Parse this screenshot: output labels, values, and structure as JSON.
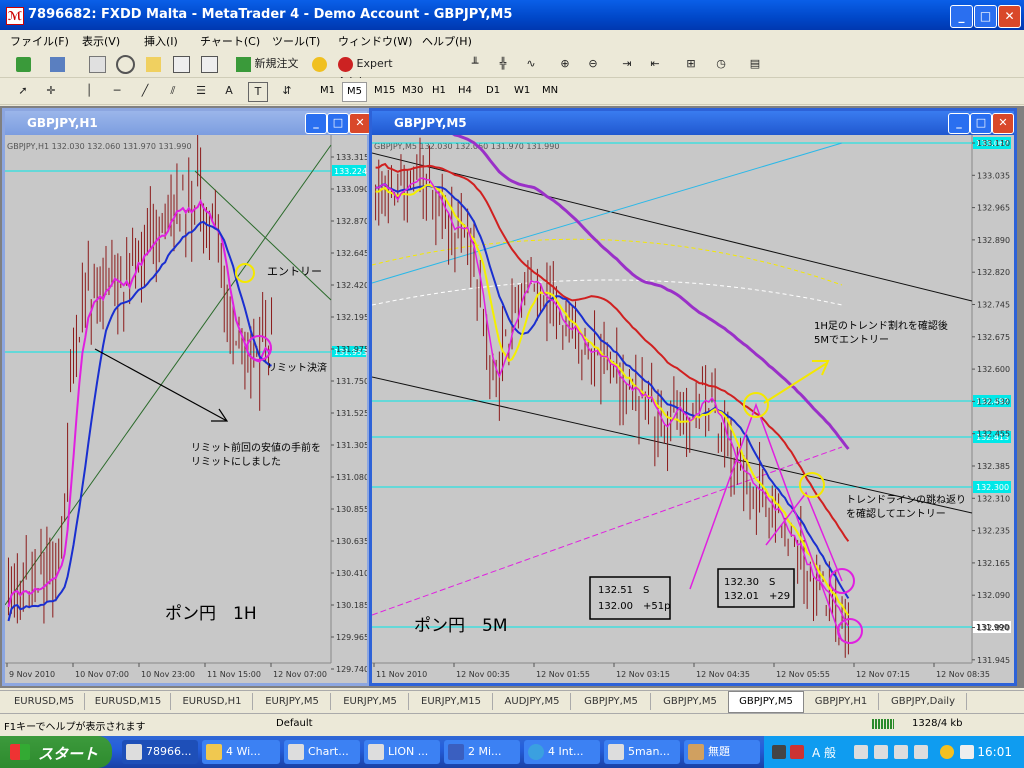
{
  "window": {
    "title": "7896682: FXDD Malta - MetaTrader 4 - Demo Account - GBPJPY,M5",
    "icon": "metatrader-icon",
    "minimize": "_",
    "maximize": "□",
    "close": "✕"
  },
  "menu": [
    "ファイル(F)",
    "表示(V)",
    "挿入(I)",
    "チャート(C)",
    "ツール(T)",
    "ウィンドウ(W)",
    "ヘルプ(H)"
  ],
  "toolbar1": {
    "new_order": "新規注文",
    "expert_advisors": "Expert Advisors"
  },
  "toolbar2": {
    "text_tool": "A",
    "label_tool": "T",
    "timeframes": [
      "M1",
      "M5",
      "M15",
      "M30",
      "H1",
      "H4",
      "D1",
      "W1",
      "MN"
    ],
    "active_timeframe": "M5"
  },
  "chart_h1": {
    "title": "GBPJPY,H1",
    "info": "GBPJPY,H1  132.030 132.060 131.970 131.990",
    "price_labels": [
      "133.315",
      "133.090",
      "132.870",
      "132.645",
      "132.420",
      "132.195",
      "131.975",
      "131.750",
      "131.525",
      "131.305",
      "131.080",
      "130.855",
      "130.635",
      "130.410",
      "130.185",
      "129.965",
      "129.740"
    ],
    "hline_top": "133.224",
    "hline_bottom": "131.953",
    "time_labels": [
      "9 Nov 2010",
      "10 Nov 07:00",
      "10 Nov 23:00",
      "11 Nov 15:00",
      "12 Nov 07:00"
    ],
    "annotations": {
      "entry": "エントリー",
      "limit_exit": "リミット決済",
      "note_line1": "リミット前回の安値の手前を",
      "note_line2": "リミットにしました",
      "big_label": "ポン円　1H"
    }
  },
  "chart_m5": {
    "title": "GBPJPY,M5",
    "info": "GBPJPY,M5  132.030 132.060 131.970 131.990",
    "price_labels": [
      "133.110",
      "133.035",
      "132.965",
      "132.890",
      "132.820",
      "132.745",
      "132.675",
      "132.600",
      "132.530",
      "132.455",
      "132.385",
      "132.310",
      "132.235",
      "132.165",
      "132.090",
      "132.020",
      "131.945"
    ],
    "hlines": [
      "133.067",
      "132.492",
      "132.413",
      "132.300",
      "131.990"
    ],
    "time_labels": [
      "11 Nov 2010",
      "12 Nov 00:35",
      "12 Nov 01:55",
      "12 Nov 03:15",
      "12 Nov 04:35",
      "12 Nov 05:55",
      "12 Nov 07:15",
      "12 Nov 08:35"
    ],
    "annotations": {
      "note1_line1": "1H足のトレンド割れを確認後",
      "note1_line2": "5Mでエントリー",
      "note2_line1": "トレンドラインの跳ね返り",
      "note2_line2": "を確認してエントリー",
      "box1_line1": "132.51　S",
      "box1_line2": "132.00　+51p",
      "box2_line1": "132.30　S",
      "box2_line2": "132.01　+29",
      "big_label": "ポン円　5M"
    }
  },
  "tabs": [
    "EURUSD,M5",
    "EURUSD,M15",
    "EURUSD,H1",
    "EURJPY,M5",
    "EURJPY,M5",
    "EURJPY,M15",
    "AUDJPY,M5",
    "GBPJPY,M5",
    "GBPJPY,M5",
    "GBPJPY,M5",
    "GBPJPY,H1",
    "GBPJPY,Daily"
  ],
  "active_tab_index": 9,
  "status": {
    "help": "F1キーでヘルプが表示されます",
    "profile": "Default",
    "traffic": "1328/4 kb"
  },
  "taskbar": {
    "start": "スタート",
    "items": [
      "78966...",
      "4 Wi...",
      "Chart...",
      "LION ...",
      "2 Mi...",
      "4 Int...",
      "5man...",
      "無題"
    ],
    "active_index": 0,
    "ime": "A 般",
    "clock": "16:01"
  },
  "colors": {
    "titlebar": "#0047c8",
    "chart_bg": "#c8c8c8",
    "candle": "#8b1a1a",
    "ma_blue": "#1a2fd0",
    "ma_magenta": "#e020e0",
    "ma_yellow": "#f4f000",
    "ma_red": "#d02020",
    "ma_purple": "#9a30c8",
    "hline": "#00e8e8"
  }
}
